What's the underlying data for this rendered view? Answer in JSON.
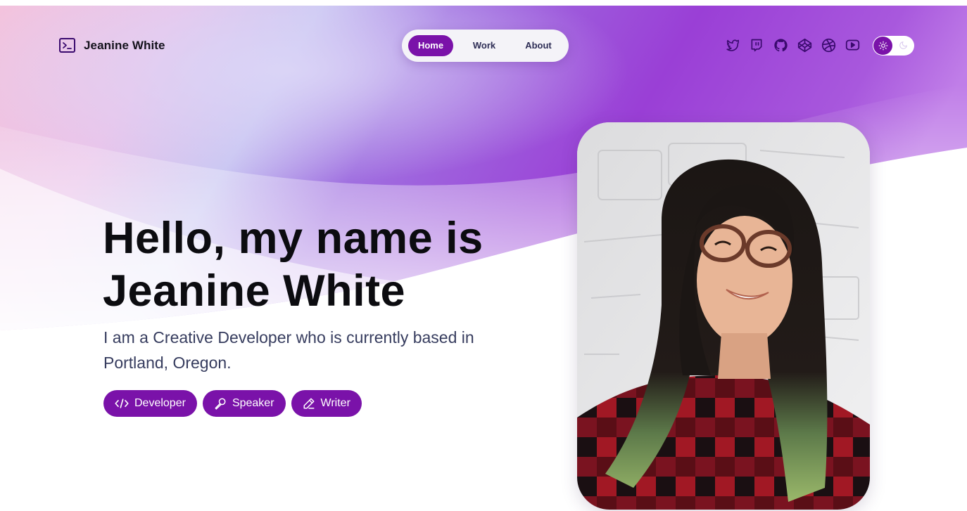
{
  "brand": {
    "name": "Jeanine White",
    "icon": "terminal-icon"
  },
  "nav": {
    "items": [
      {
        "label": "Home",
        "active": true
      },
      {
        "label": "Work",
        "active": false
      },
      {
        "label": "About",
        "active": false
      }
    ]
  },
  "socials": [
    "twitter-icon",
    "twitch-icon",
    "github-icon",
    "codepen-icon",
    "dribbble-icon",
    "youtube-icon"
  ],
  "theme_toggle": {
    "state": "light",
    "icons": [
      "sun-icon",
      "moon-icon"
    ]
  },
  "hero": {
    "title_line1": "Hello, my name is",
    "title_line2": "Jeanine White",
    "subtitle": "I am a Creative Developer who is currently based in Portland, Oregon.",
    "tags": [
      {
        "label": "Developer",
        "icon": "code-icon"
      },
      {
        "label": "Speaker",
        "icon": "microphone-icon"
      },
      {
        "label": "Writer",
        "icon": "pen-icon"
      }
    ]
  },
  "colors": {
    "accent": "#7a12a9",
    "title": "#0c0c10",
    "subtitle": "#363c5e",
    "nav_bg": "#f4f3f8"
  }
}
